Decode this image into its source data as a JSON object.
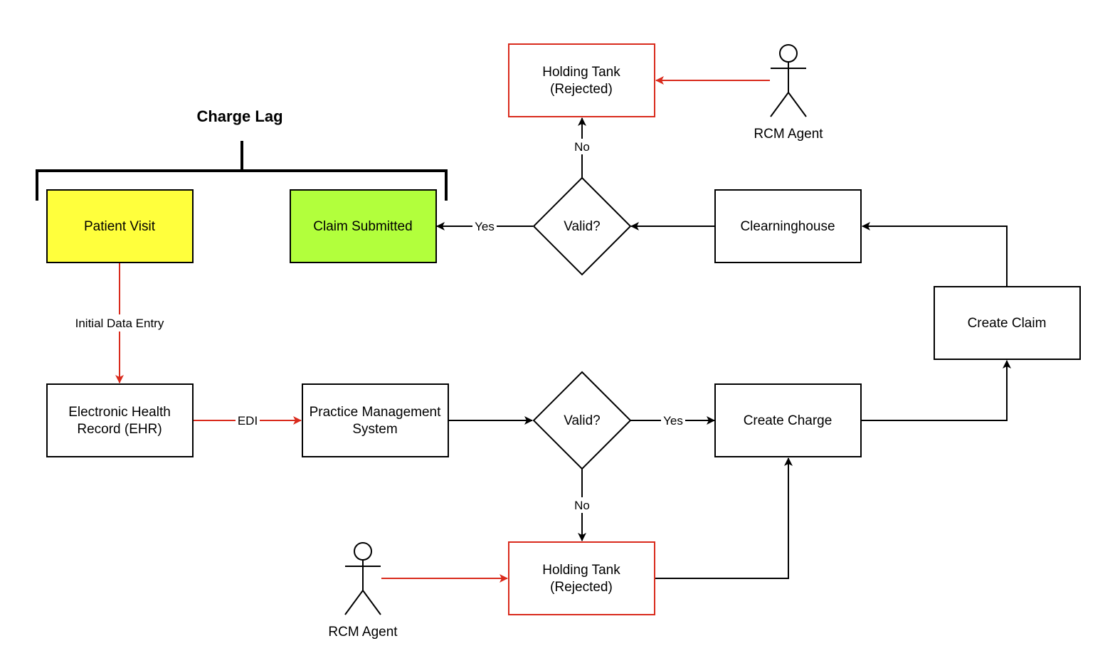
{
  "diagram": {
    "title": "Charge Lag",
    "colors": {
      "patient_visit_fill": "#ffff3c",
      "claim_submitted_fill": "#b2ff3c",
      "rejected_stroke": "#d92a1c",
      "default_stroke": "#000000",
      "manual_flow": "#d92a1c"
    },
    "nodes": {
      "patient_visit": "Patient Visit",
      "claim_submitted": "Claim Submitted",
      "valid_top": "Valid?",
      "clearinghouse": "Clearninghouse",
      "holding_tank_top_l1": "Holding Tank",
      "holding_tank_top_l2": "(Rejected)",
      "create_claim": "Create Claim",
      "ehr_l1": "Electronic Health",
      "ehr_l2": "Record (EHR)",
      "pms_l1": "Practice Management",
      "pms_l2": "System",
      "valid_bottom": "Valid?",
      "create_charge": "Create Charge",
      "holding_tank_bottom_l1": "Holding Tank",
      "holding_tank_bottom_l2": "(Rejected)"
    },
    "actors": {
      "top": "RCM Agent",
      "bottom": "RCM Agent"
    },
    "edge_labels": {
      "initial_data_entry": "Initial Data Entry",
      "edi": "EDI",
      "top_yes": "Yes",
      "top_no": "No",
      "bottom_yes": "Yes",
      "bottom_no": "No"
    }
  }
}
